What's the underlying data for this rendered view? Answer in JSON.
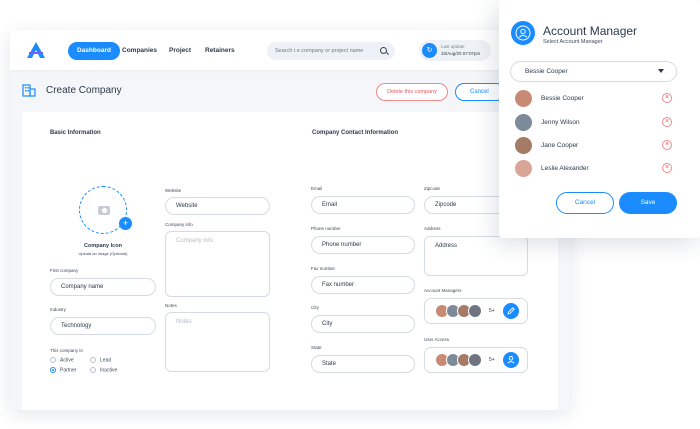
{
  "nav": {
    "items": [
      {
        "label": "Dashboard",
        "active": true
      },
      {
        "label": "Companies",
        "active": false
      },
      {
        "label": "Project",
        "active": false
      },
      {
        "label": "Retainers",
        "active": false
      }
    ],
    "search_placeholder": "Search i.e company or project name",
    "last_update_label": "Last update",
    "last_update_time": "10/Aug/20 07:07pm"
  },
  "header": {
    "title": "Create Company",
    "delete_label": "Delete this company",
    "cancel_label": "Cancel"
  },
  "basic": {
    "section_title": "Basic Information",
    "company_icon_label": "Company Icon",
    "company_icon_hint": "Upload an image (Optional)",
    "first_company_label": "First company",
    "company_name_value": "Company name",
    "industry_label": "Industry",
    "industry_value": "Technology",
    "status_label": "This company is:",
    "status_options": [
      {
        "label": "Active",
        "selected": false
      },
      {
        "label": "Lead",
        "selected": false
      },
      {
        "label": "Partner",
        "selected": true
      },
      {
        "label": "Inactive",
        "selected": false
      }
    ],
    "website_label": "Website",
    "website_value": "Website",
    "company_info_label": "Company info",
    "company_info_placeholder": "Company info",
    "notes_label": "Notes",
    "notes_placeholder": "Notes"
  },
  "contact": {
    "section_title": "Company Contact Information",
    "email_label": "Email",
    "email_value": "Email",
    "phone_label": "Phone number",
    "phone_value": "Phone number",
    "fax_label": "Fax number",
    "fax_value": "Fax number",
    "city_label": "City",
    "city_value": "City",
    "state_label": "State",
    "state_value": "State",
    "zipcode_label": "Zipcode",
    "zipcode_value": "Zipcode",
    "address_label": "Address",
    "address_value": "Address",
    "account_managers_label": "Account Managers",
    "account_managers_more": "5+",
    "user_access_label": "User Access",
    "user_access_more": "5+"
  },
  "panel": {
    "title": "Account Manager",
    "subtitle": "Select Account Manager",
    "selected": "Bessie Cooper",
    "people": [
      {
        "name": "Bessie Cooper",
        "color": "#c98a73"
      },
      {
        "name": "Jenny Wilson",
        "color": "#7d8a99"
      },
      {
        "name": "Jane Cooper",
        "color": "#a57b66"
      },
      {
        "name": "Leslie Alexander",
        "color": "#d8a597"
      }
    ],
    "remove_symbol": "×",
    "cancel_label": "Cancel",
    "save_label": "Save"
  },
  "colors": {
    "accent": "#1a8cff",
    "danger": "#e5575b"
  }
}
